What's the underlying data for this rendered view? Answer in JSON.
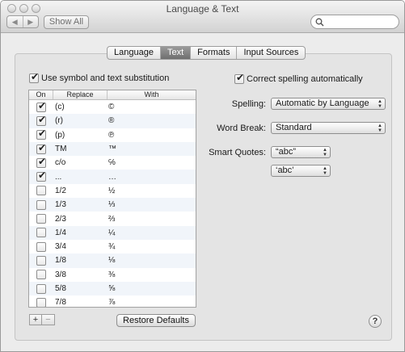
{
  "window": {
    "title": "Language & Text"
  },
  "toolbar": {
    "back_glyph": "◀",
    "forward_glyph": "▶",
    "show_all_label": "Show All",
    "search_placeholder": ""
  },
  "tabs": [
    {
      "label": "Language",
      "selected": false
    },
    {
      "label": "Text",
      "selected": true
    },
    {
      "label": "Formats",
      "selected": false
    },
    {
      "label": "Input Sources",
      "selected": false
    }
  ],
  "substitution": {
    "checkbox_label": "Use symbol and text substitution",
    "checked": true,
    "columns": {
      "on": "On",
      "replace": "Replace",
      "with": "With"
    },
    "rows": [
      {
        "on": true,
        "replace": "(c)",
        "with": "©"
      },
      {
        "on": true,
        "replace": "(r)",
        "with": "®"
      },
      {
        "on": true,
        "replace": "(p)",
        "with": "℗"
      },
      {
        "on": true,
        "replace": "TM",
        "with": "™"
      },
      {
        "on": true,
        "replace": "c/o",
        "with": "℅"
      },
      {
        "on": true,
        "replace": "...",
        "with": "…"
      },
      {
        "on": false,
        "replace": "1/2",
        "with": "½"
      },
      {
        "on": false,
        "replace": "1/3",
        "with": "⅓"
      },
      {
        "on": false,
        "replace": "2/3",
        "with": "⅔"
      },
      {
        "on": false,
        "replace": "1/4",
        "with": "¼"
      },
      {
        "on": false,
        "replace": "3/4",
        "with": "¾"
      },
      {
        "on": false,
        "replace": "1/8",
        "with": "⅛"
      },
      {
        "on": false,
        "replace": "3/8",
        "with": "⅜"
      },
      {
        "on": false,
        "replace": "5/8",
        "with": "⅝"
      },
      {
        "on": false,
        "replace": "7/8",
        "with": "⅞"
      }
    ],
    "add_label": "+",
    "remove_label": "−",
    "restore_defaults_label": "Restore Defaults"
  },
  "spelling": {
    "correct_label": "Correct spelling automatically",
    "correct_checked": true,
    "spelling_label": "Spelling:",
    "spelling_value": "Automatic by Language",
    "word_break_label": "Word Break:",
    "word_break_value": "Standard",
    "smart_quotes_label": "Smart Quotes:",
    "double_quotes_value": "“abc”",
    "single_quotes_value": "‘abc’"
  },
  "help_label": "?"
}
